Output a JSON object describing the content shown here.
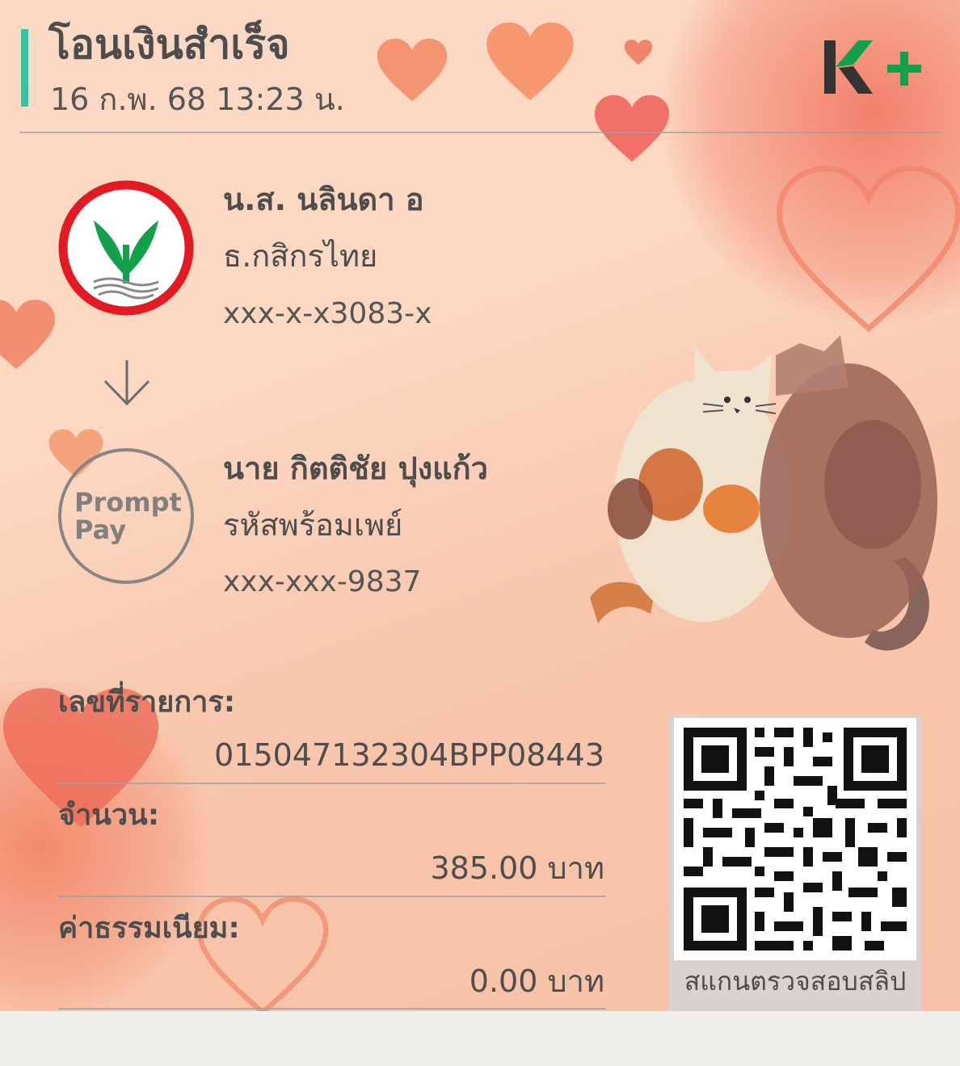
{
  "header": {
    "title": "โอนเงินสำเร็จ",
    "datetime": "16 ก.พ. 68  13:23 น.",
    "brand_logo": "K+"
  },
  "sender": {
    "name": "น.ส. นลินดา อ",
    "bank": "ธ.กสิกรไทย",
    "account": "xxx-x-x3083-x",
    "logo_icon": "kbank-logo-icon"
  },
  "receiver": {
    "name": "นาย กิตติชัย ปุงแก้ว",
    "type": "รหัสพร้อมเพย์",
    "account": "xxx-xxx-9837",
    "logo_line1": "Prompt",
    "logo_line2": "Pay"
  },
  "details": {
    "ref_label": "เลขที่รายการ:",
    "ref_value": "015047132304BPP08443",
    "amount_label": "จำนวน:",
    "amount_value": "385.00 บาท",
    "fee_label": "ค่าธรรมเนียม:",
    "fee_value": "0.00 บาท"
  },
  "qr": {
    "caption": "สแกนตรวจสอบสลิป"
  },
  "colors": {
    "accent_teal": "#3ac2a8",
    "kbank_green": "#13a04a",
    "kbank_red": "#e21b23",
    "heart": "#f07a5a"
  }
}
